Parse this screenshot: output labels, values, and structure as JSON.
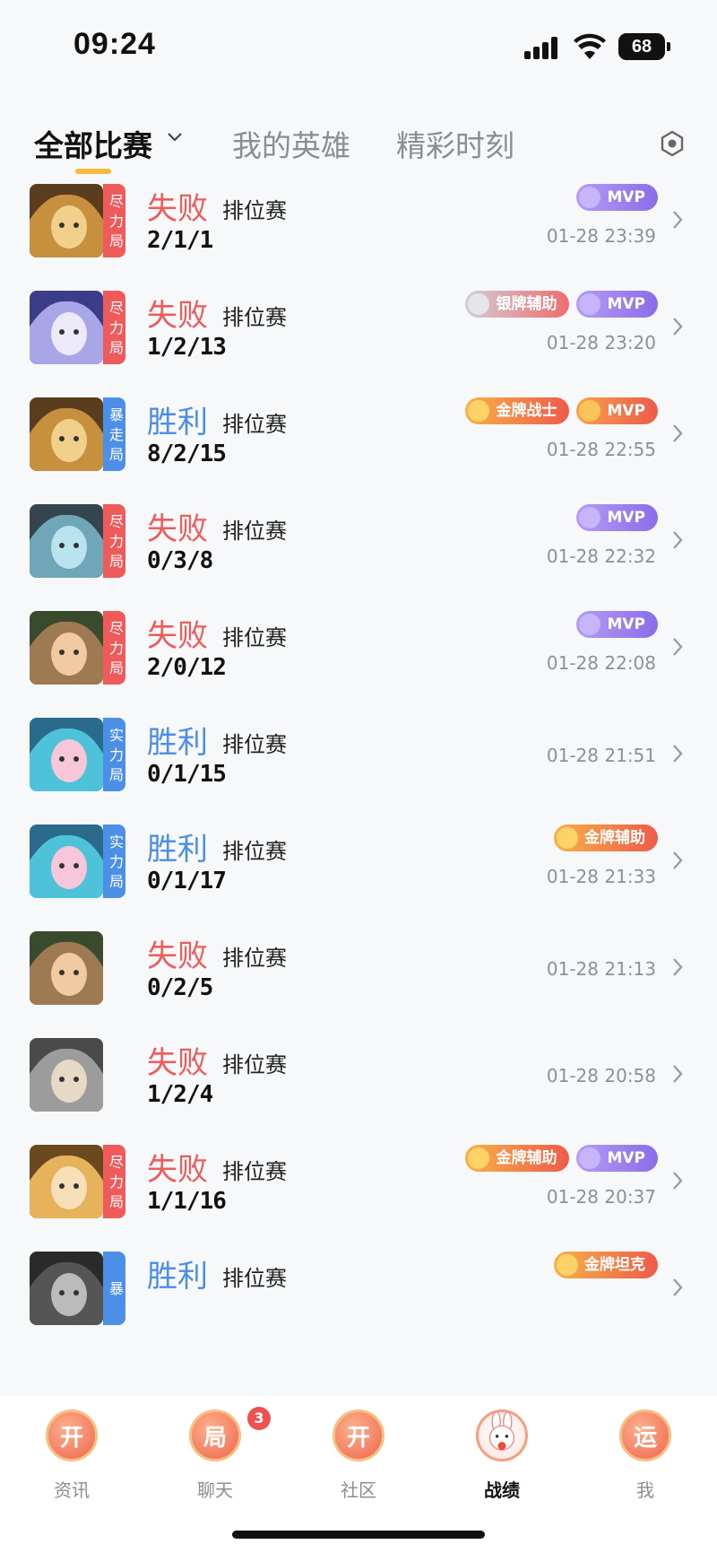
{
  "status_bar": {
    "time": "09:24",
    "battery": "68"
  },
  "tabs": [
    {
      "label": "全部比赛",
      "active": true
    },
    {
      "label": "我的英雄",
      "active": false
    },
    {
      "label": "精彩时刻",
      "active": false
    }
  ],
  "matches": [
    {
      "result": "失败",
      "type": "排位赛",
      "kda": "2/1/1",
      "time": "01-28 23:39",
      "tag": "尽力局",
      "badges": [
        "MVP"
      ]
    },
    {
      "result": "失败",
      "type": "排位赛",
      "kda": "1/2/13",
      "time": "01-28 23:20",
      "tag": "尽力局",
      "badges": [
        "银牌辅助",
        "MVP"
      ]
    },
    {
      "result": "胜利",
      "type": "排位赛",
      "kda": "8/2/15",
      "time": "01-28 22:55",
      "tag": "暴走局",
      "badges": [
        "金牌战士",
        "MVP"
      ]
    },
    {
      "result": "失败",
      "type": "排位赛",
      "kda": "0/3/8",
      "time": "01-28 22:32",
      "tag": "尽力局",
      "badges": [
        "MVP"
      ]
    },
    {
      "result": "失败",
      "type": "排位赛",
      "kda": "2/0/12",
      "time": "01-28 22:08",
      "tag": "尽力局",
      "badges": [
        "MVP"
      ]
    },
    {
      "result": "胜利",
      "type": "排位赛",
      "kda": "0/1/15",
      "time": "01-28 21:51",
      "tag": "实力局",
      "badges": []
    },
    {
      "result": "胜利",
      "type": "排位赛",
      "kda": "0/1/17",
      "time": "01-28 21:33",
      "tag": "实力局",
      "badges": [
        "金牌辅助"
      ]
    },
    {
      "result": "失败",
      "type": "排位赛",
      "kda": "0/2/5",
      "time": "01-28 21:13",
      "tag": "",
      "badges": []
    },
    {
      "result": "失败",
      "type": "排位赛",
      "kda": "1/2/4",
      "time": "01-28 20:58",
      "tag": "",
      "badges": []
    },
    {
      "result": "失败",
      "type": "排位赛",
      "kda": "1/1/16",
      "time": "01-28 20:37",
      "tag": "尽力局",
      "badges": [
        "金牌辅助",
        "MVP"
      ]
    },
    {
      "result": "胜利",
      "type": "排位赛",
      "kda": "",
      "time": "",
      "tag": "暴",
      "badges": [
        "金牌坦克"
      ]
    }
  ],
  "bottom_nav": [
    {
      "label": "资讯",
      "icon": "开",
      "active": false,
      "badge": ""
    },
    {
      "label": "聊天",
      "icon": "局",
      "active": false,
      "badge": "3"
    },
    {
      "label": "社区",
      "icon": "开",
      "active": false,
      "badge": ""
    },
    {
      "label": "战绩",
      "icon": "",
      "active": true,
      "badge": ""
    },
    {
      "label": "我",
      "icon": "运",
      "active": false,
      "badge": ""
    }
  ],
  "colors": {
    "win": "#4a8ee6",
    "lose": "#ee5b5b",
    "accent": "#f5b93c"
  }
}
